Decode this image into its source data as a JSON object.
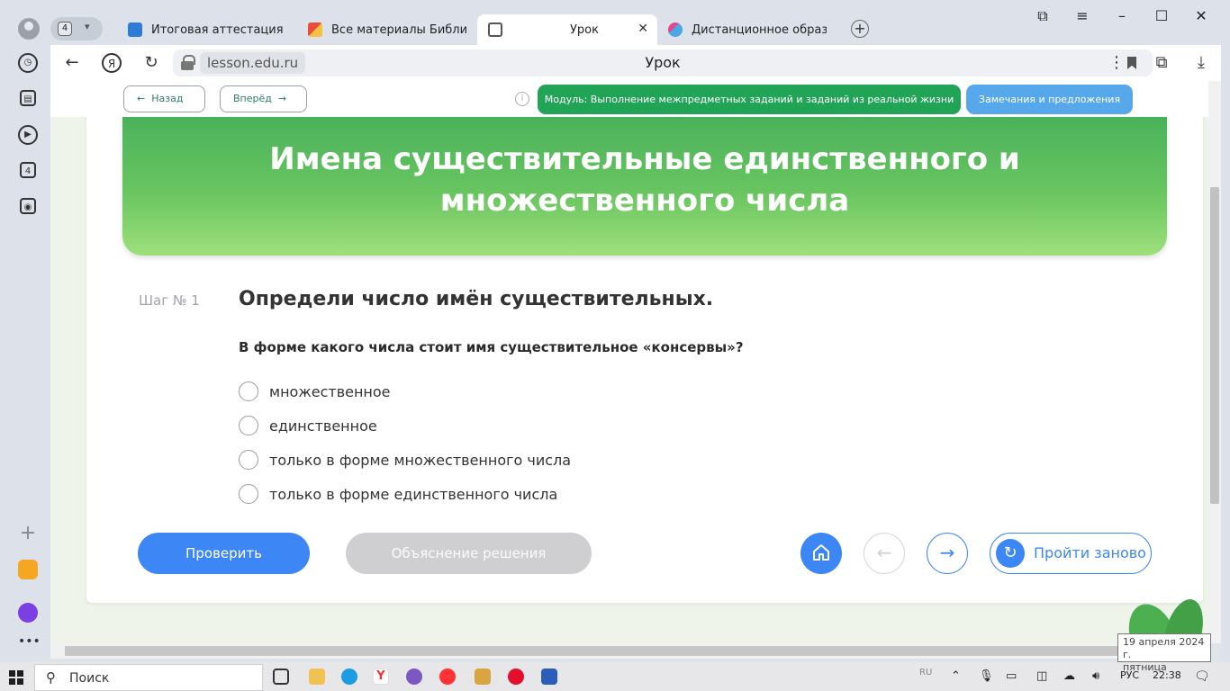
{
  "browser": {
    "tab_group_count": "4",
    "tabs": [
      {
        "label": "Итоговая аттестация [отв"
      },
      {
        "label": "Все материалы Библиоте"
      },
      {
        "label": "Урок"
      },
      {
        "label": "Дистанционное образова"
      }
    ],
    "url_domain": "lesson.edu.ru",
    "page_title": "Урок",
    "sidebar_badge": "4"
  },
  "toolbar": {
    "back_label": "Назад",
    "forward_label": "Вперёд",
    "module_label": "Модуль: Выполнение межпредметных заданий и заданий из реальной жизни",
    "remarks_label": "Замечания и предложения"
  },
  "lesson": {
    "title": "Имена существительные единственного и множественного числа",
    "step_label": "Шаг № 1",
    "step_title": "Определи число имён существительных.",
    "question": "В форме какого числа стоит имя существительное «консервы»?",
    "options": [
      {
        "label": "множественное"
      },
      {
        "label": "единственное"
      },
      {
        "label": "только в форме множественного числа"
      },
      {
        "label": "только в форме единственного числа"
      }
    ],
    "check_label": "Проверить",
    "explain_label": "Объяснение решения",
    "restart_label": "Пройти заново"
  },
  "tooltip": {
    "date": "19 апреля 2024 г.",
    "weekday": "пятница"
  },
  "taskbar": {
    "search_label": "Поиск",
    "lang_small": "RU",
    "lang": "РУС",
    "time": "22:38"
  },
  "colors": {
    "primary_blue": "#3d86f5",
    "module_green": "#22a457",
    "remarks_blue": "#56a8ea",
    "banner_green": "#43ad5b"
  }
}
